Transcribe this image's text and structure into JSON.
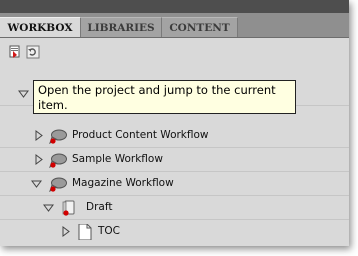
{
  "tabs": [
    {
      "label": "WORKBOX",
      "active": true
    },
    {
      "label": "LIBRARIES",
      "active": false
    },
    {
      "label": "CONTENT",
      "active": false
    }
  ],
  "toolbar": {
    "buttons": [
      {
        "icon": "open-project-icon"
      },
      {
        "icon": "refresh-icon"
      }
    ]
  },
  "tooltip": {
    "text": "Open the project and jump to the current item."
  },
  "tree": {
    "items": [
      {
        "label": "Product Content Workflow",
        "expanded": false,
        "icon": "workflow-icon"
      },
      {
        "label": "Sample Workflow",
        "expanded": false,
        "icon": "workflow-icon"
      },
      {
        "label": "Magazine Workflow",
        "expanded": true,
        "icon": "workflow-icon"
      },
      {
        "label": "Draft",
        "expanded": true,
        "icon": "stage-icon"
      },
      {
        "label": "TOC",
        "expanded": false,
        "icon": "document-icon"
      }
    ]
  },
  "colors": {
    "panel_bg": "#d9d9d9",
    "tab_bar_bg": "#8f8f8f",
    "tooltip_bg": "#ffffe1",
    "status_red": "#d10000"
  }
}
